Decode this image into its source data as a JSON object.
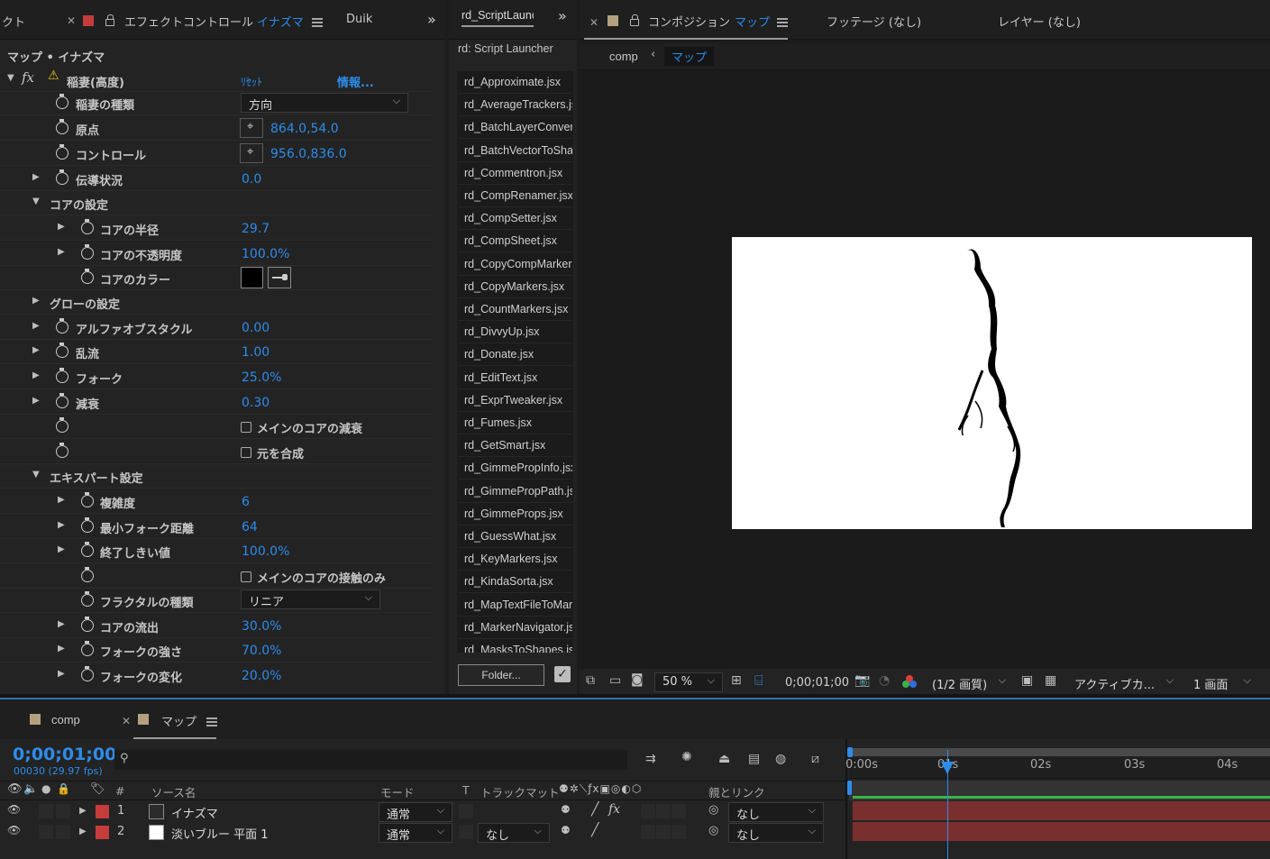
{
  "effect_panel": {
    "left_tab_fragment": "クト",
    "tab_title_prefix": "エフェクトコントロール",
    "tab_title_layer": "イナズマ",
    "duik_tab": "Duik",
    "breadcrumb": "マップ • イナズマ",
    "effect_name": "稲妻(高度)",
    "reset_label": "ﾘｾｯﾄ",
    "about_label": "情報...",
    "fx_label": "fx",
    "properties": [
      {
        "name": "稲妻の種類",
        "kind": "dropdown",
        "value": "方向"
      },
      {
        "name": "原点",
        "kind": "point",
        "value": "864.0,54.0"
      },
      {
        "name": "コントロール",
        "kind": "point",
        "value": "956.0,836.0"
      },
      {
        "name": "伝導状況",
        "kind": "value",
        "value": "0.0"
      },
      {
        "name": "コアの設定",
        "kind": "group"
      },
      {
        "name": "コアの半径",
        "kind": "value",
        "value": "29.7"
      },
      {
        "name": "コアの不透明度",
        "kind": "value",
        "value": "100.0%"
      },
      {
        "name": "コアのカラー",
        "kind": "color",
        "value": "#000000"
      },
      {
        "name": "グローの設定",
        "kind": "group"
      },
      {
        "name": "アルファオブスタクル",
        "kind": "value",
        "value": "0.00"
      },
      {
        "name": "乱流",
        "kind": "value",
        "value": "1.00"
      },
      {
        "name": "フォーク",
        "kind": "value",
        "value": "25.0%"
      },
      {
        "name": "減衰",
        "kind": "value",
        "value": "0.30"
      },
      {
        "name": "メインのコアの減衰",
        "kind": "checkbox"
      },
      {
        "name": "元を合成",
        "kind": "checkbox"
      },
      {
        "name": "エキスパート設定",
        "kind": "group"
      },
      {
        "name": "複雑度",
        "kind": "value",
        "value": "6"
      },
      {
        "name": "最小フォーク距離",
        "kind": "value",
        "value": "64"
      },
      {
        "name": "終了しきい値",
        "kind": "value",
        "value": "100.0%"
      },
      {
        "name": "メインのコアの接触のみ",
        "kind": "checkbox"
      },
      {
        "name": "フラクタルの種類",
        "kind": "dropdown",
        "value": "リニア"
      },
      {
        "name": "コアの流出",
        "kind": "value",
        "value": "30.0%"
      },
      {
        "name": "フォークの強さ",
        "kind": "value",
        "value": "70.0%"
      },
      {
        "name": "フォークの変化",
        "kind": "value",
        "value": "20.0%"
      }
    ]
  },
  "script_panel": {
    "tab": "rd_ScriptLaunc",
    "title": "rd: Script Launcher",
    "scripts": [
      "rd_Approximate.jsx",
      "rd_AverageTrackers.jsx",
      "rd_BatchLayerConvert",
      "rd_BatchVectorToShap",
      "rd_Commentron.jsx",
      "rd_CompRenamer.jsx",
      "rd_CompSetter.jsx",
      "rd_CompSheet.jsx",
      "rd_CopyCompMarkers",
      "rd_CopyMarkers.jsx",
      "rd_CountMarkers.jsx",
      "rd_DivvyUp.jsx",
      "rd_Donate.jsx",
      "rd_EditText.jsx",
      "rd_ExprTweaker.jsx",
      "rd_Fumes.jsx",
      "rd_GetSmart.jsx",
      "rd_GimmePropInfo.jsx",
      "rd_GimmePropPath.js",
      "rd_GimmeProps.jsx",
      "rd_GuessWhat.jsx",
      "rd_KeyMarkers.jsx",
      "rd_KindaSorta.jsx",
      "rd_MapTextFileToMark",
      "rd_MarkerNavigator.js",
      "rd_MasksToShapes.jsx"
    ],
    "folder_button": "Folder..."
  },
  "composition_panel": {
    "tab_prefix": "コンポジション",
    "tab_comp": "マップ",
    "footage_tab": "フッテージ (なし)",
    "layer_tab": "レイヤー (なし)",
    "crumb_parent": "comp",
    "crumb_current": "マップ",
    "zoom": "50 %",
    "timecode": "0;00;01;00",
    "resolution": "(1/2 画質)",
    "camera": "アクティブカ...",
    "views": "1 画面"
  },
  "timeline": {
    "tab_comp": "comp",
    "tab_map": "マップ",
    "timecode": "0;00;01;00",
    "frame_info": "00030 (29.97 fps)",
    "search_placeholder": "",
    "columns": {
      "num": "#",
      "source": "ソース名",
      "mode": "モード",
      "t": "T",
      "trackmatte": "トラックマット",
      "parent": "親とリンク"
    },
    "ruler": [
      "0:00s",
      "01s",
      "02s",
      "03s",
      "04s"
    ],
    "layers": [
      {
        "num": "1",
        "name": "イナズマ",
        "mode": "通常",
        "trackmatte": "",
        "parent": "なし",
        "label_color": "#c63b3b",
        "swatch": "#2b2b2b"
      },
      {
        "num": "2",
        "name": "淡いブルー 平面 1",
        "mode": "通常",
        "trackmatte": "なし",
        "parent": "なし",
        "label_color": "#c63b3b",
        "swatch": "#ffffff"
      }
    ]
  }
}
